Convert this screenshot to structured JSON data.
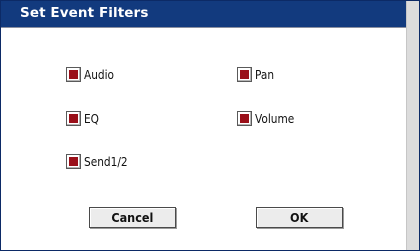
{
  "dialog": {
    "title": "Set Event Filters",
    "checkboxes": [
      {
        "label": "Audio",
        "checked": true
      },
      {
        "label": "EQ",
        "checked": true
      },
      {
        "label": "Send1/2",
        "checked": true
      },
      {
        "label": "Pan",
        "checked": true
      },
      {
        "label": "Volume",
        "checked": true
      }
    ],
    "buttons": {
      "cancel": "Cancel",
      "ok": "OK"
    }
  },
  "colors": {
    "titlebar": "#123a7e",
    "check_mark": "#9a0f19"
  }
}
